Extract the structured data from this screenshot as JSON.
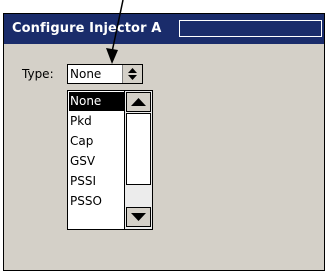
{
  "window": {
    "title": "Configure Injector A",
    "title_field_value": ""
  },
  "form": {
    "type_label": "Type:",
    "type_selected": "None"
  },
  "dropdown": {
    "options": [
      "None",
      "Pkd",
      "Cap",
      "GSV",
      "PSSI",
      "PSSO"
    ],
    "highlighted": "None"
  },
  "colors": {
    "titlebar_bg": "#1a2c6b",
    "title_text": "#ffffff",
    "window_bg": "#d4d0c8",
    "selection_bg": "#000000"
  },
  "icons": {
    "spin": "up-down-spin-icon",
    "scroll_up": "scroll-up-arrow-icon",
    "scroll_down": "scroll-down-arrow-icon",
    "annotation": "pointer-arrow-icon"
  }
}
